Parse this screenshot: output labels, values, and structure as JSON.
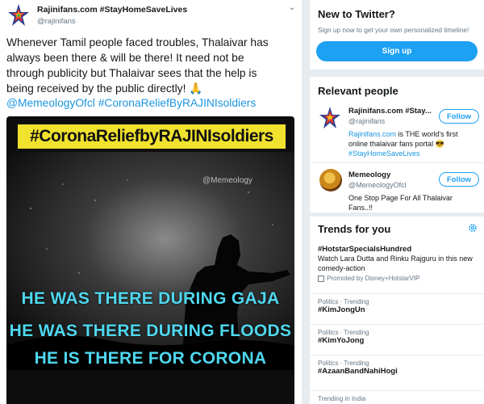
{
  "tweet": {
    "display_name": "Rajinifans.com #StayHomeSaveLives",
    "handle": "@rajinifans",
    "caret": "⌄",
    "body_lines": [
      "Whenever Tamil people faced troubles, Thalaivar has",
      "always been there & will be there! It need not be",
      "through publicity but Thalaivar sees that the help is",
      "being received by the public directly! 🙏"
    ],
    "mention": "@MemeologyOfcl",
    "hashtag": "#CoronaReliefByRAJINIsoldiers",
    "media": {
      "banner": "#CoronaReliefbyRAJINIsoldiers",
      "watermark": "@Memeology",
      "slogans": [
        "HE WAS THERE DURING GAJA",
        "HE WAS THERE DURING FLOODS",
        "HE IS THERE FOR CORONA"
      ]
    }
  },
  "new_to_twitter": {
    "title": "New to Twitter?",
    "subtitle": "Sign up now to get your own personalized timeline!",
    "signup_label": "Sign up"
  },
  "relevant_people": {
    "title": "Relevant people",
    "people": [
      {
        "name": "Rajinifans.com #Stay...",
        "handle": "@rajinifans",
        "bio_link": "Rajinifans.com",
        "bio_rest": " is THE world's first online thalaivar fans portal 😎",
        "bio_hashtag": "#StayHomeSaveLives",
        "follow_label": "Follow"
      },
      {
        "name": "Memeology",
        "handle": "@MemeologyOfcl",
        "bio": "One Stop Page For All Thalaivar Fans..!!",
        "follow_label": "Follow"
      }
    ]
  },
  "trends": {
    "title": "Trends for you",
    "items": [
      {
        "name": "#HotstarSpecialsHundred",
        "desc": "Watch Lara Dutta and Rinku Rajguru in this new comedy-action",
        "promo": "Promoted by Disney+HotstarVIP"
      },
      {
        "meta": "Politics · Trending",
        "name": "#KimJongUn"
      },
      {
        "meta": "Politics · Trending",
        "name": "#KimYoJong"
      },
      {
        "meta": "Politics · Trending",
        "name": "#AzaanBandNahiHogi"
      },
      {
        "meta": "Trending in India"
      }
    ]
  },
  "colors": {
    "twitter_blue": "#1da1f2",
    "link_blue": "#1b95e0",
    "banner_yellow": "#f1e22e",
    "slogan_cyan": "#4fd8ef",
    "page_bg": "#e6ecf0"
  }
}
